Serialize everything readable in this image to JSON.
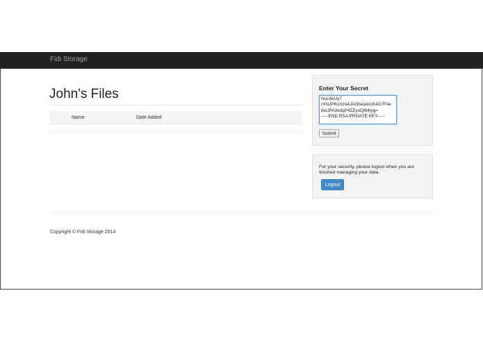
{
  "navbar": {
    "brand": "Fidi Storage"
  },
  "main": {
    "title": "John's Files",
    "table": {
      "columns": [
        "",
        "Name",
        "Date Added"
      ],
      "rows": []
    }
  },
  "secret_panel": {
    "title": "Enter Your Secret",
    "textarea_value": "NsL6eUy7\nrXNJPKoXzo4JAObeaxli1K4G7F4e\n6eiJPA3kdqP4ZZyoQ8t4Iyg=\n-----END RSA PRIVATE KEY-----",
    "submit_label": "Submit"
  },
  "logout_panel": {
    "message": "For your security, please logout when you are finished managing your data.",
    "button_label": "Logout"
  },
  "footer": {
    "copyright": "Copyright © Fidi Storage 2014"
  },
  "colors": {
    "navbar": "#222222",
    "brand_text": "#9d9d9d",
    "primary_button": "#428bca",
    "panel_bg": "#f4f4f4"
  }
}
